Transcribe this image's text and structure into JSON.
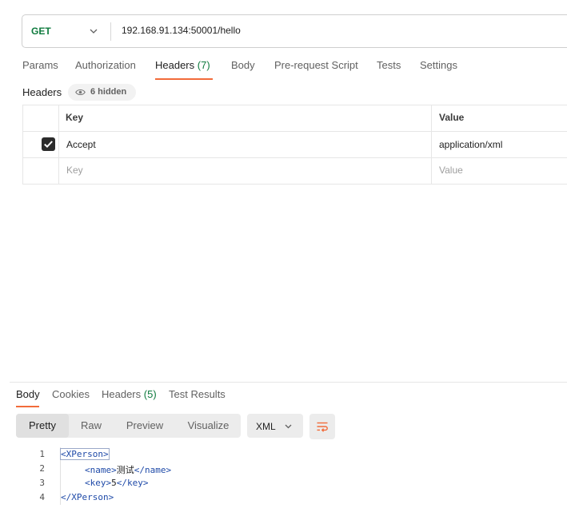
{
  "request": {
    "method": "GET",
    "url": "192.168.91.134:50001/hello"
  },
  "request_tabs": {
    "params": "Params",
    "authorization": "Authorization",
    "headers_label": "Headers",
    "headers_count": "(7)",
    "body": "Body",
    "pre_request": "Pre-request Script",
    "tests": "Tests",
    "settings": "Settings"
  },
  "headers_section": {
    "title": "Headers",
    "hidden_label": "6 hidden",
    "columns": {
      "key": "Key",
      "value": "Value"
    },
    "rows": [
      {
        "checked": true,
        "key": "Accept",
        "value": "application/xml"
      }
    ],
    "placeholder": {
      "key": "Key",
      "value": "Value"
    }
  },
  "response_tabs": {
    "body": "Body",
    "cookies": "Cookies",
    "headers_label": "Headers",
    "headers_count": "(5)",
    "test_results": "Test Results"
  },
  "view_modes": {
    "pretty": "Pretty",
    "raw": "Raw",
    "preview": "Preview",
    "visualize": "Visualize",
    "selected": "Pretty"
  },
  "format": {
    "selected": "XML"
  },
  "code_lines": [
    {
      "num": "1",
      "open": "<XPerson>",
      "text": "",
      "close": ""
    },
    {
      "num": "2",
      "open": "<name>",
      "text": "测试",
      "close": "</name>"
    },
    {
      "num": "3",
      "open": "<key>",
      "text": "5",
      "close": "</key>"
    },
    {
      "num": "4",
      "open": "</XPerson>",
      "text": "",
      "close": ""
    }
  ],
  "colors": {
    "accent": "#f26b3a",
    "method_get": "#0f7b3e",
    "xml_tag": "#1f4aa8"
  },
  "icons": {
    "method_dropdown": "chevron-down-icon",
    "hidden_headers": "eye-icon",
    "header_checkbox": "checkbox-checked-icon",
    "format_dropdown": "chevron-down-icon",
    "wrap": "wrap-lines-icon"
  }
}
